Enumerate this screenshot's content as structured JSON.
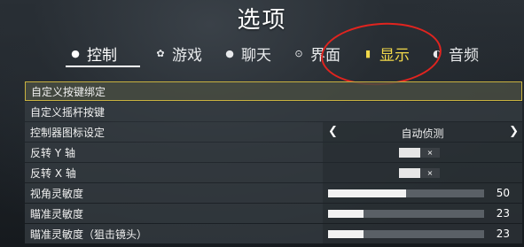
{
  "title": "选项",
  "tabs": [
    {
      "label": "控制",
      "icon": "controller-icon",
      "active": true
    },
    {
      "label": "游戏",
      "icon": "gear-icon"
    },
    {
      "label": "聊天",
      "icon": "chat-icon"
    },
    {
      "label": "界面",
      "icon": "interface-icon"
    },
    {
      "label": "显示",
      "icon": "display-icon"
    },
    {
      "label": "音频",
      "icon": "speaker-icon"
    }
  ],
  "rows": [
    {
      "label": "自定义按键绑定",
      "type": "link",
      "selected": true
    },
    {
      "label": "自定义摇杆按键",
      "type": "link"
    },
    {
      "label": "控制器图标设定",
      "type": "selector",
      "value": "自动侦测"
    },
    {
      "label": "反转 Y 轴",
      "type": "toggle",
      "state_text": "×"
    },
    {
      "label": "反转 X 轴",
      "type": "toggle",
      "state_text": "×"
    },
    {
      "label": "视角灵敏度",
      "type": "slider",
      "value": "50",
      "fraction": 0.5
    },
    {
      "label": "瞄准灵敏度",
      "type": "slider",
      "value": "23",
      "fraction": 0.23
    },
    {
      "label": "瞄准灵敏度（狙击镜头）",
      "type": "slider",
      "value": "23",
      "fraction": 0.23
    }
  ],
  "colors": {
    "accent_border": "#c9b240",
    "highlight_tab": "#f2d94a",
    "annotation": "#e0241f"
  }
}
